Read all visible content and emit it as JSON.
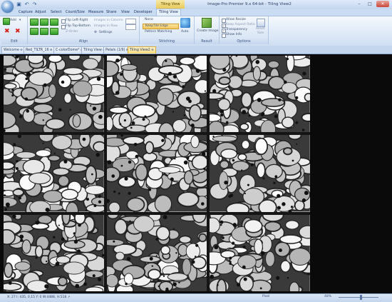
{
  "app": {
    "title": "Image-Pro Premier 9.x 64-bit - Tiling View2",
    "context_tab": "Tiling View"
  },
  "window_controls": {
    "minimize": "–",
    "maximize": "□",
    "close": "✕"
  },
  "quick_access": [
    "save-icon",
    "undo-icon",
    "redo-icon"
  ],
  "menu": {
    "tabs": [
      "Capture",
      "Adjust",
      "Select",
      "Count/Size",
      "Measure",
      "Share",
      "View",
      "Developer"
    ],
    "context": "Tiling View"
  },
  "ribbon": {
    "edit": {
      "label": "Edit",
      "add": "Add",
      "add_caret": "▾"
    },
    "align": {
      "label": "Align",
      "flip_left_right": "Flip Left-Right",
      "flip_top_bottom": "Flip Top-Bottom",
      "z_order": "Z-Order",
      "images_in_column": "Images in Column",
      "images_in_row": "Images in Row",
      "settings": "Settings",
      "column_value": "3",
      "row_value": "3"
    },
    "stitching": {
      "label": "Stitching",
      "none": "None",
      "keep_tile": "KeepTile Edge",
      "pattern_matching": "Pattern Matching",
      "auto": "Auto"
    },
    "result": {
      "label": "Result",
      "create_image": "Create Image"
    },
    "options": {
      "label": "Options",
      "allow_resize": "Allow Resize",
      "keep_aspect": "Keep Aspect Ratio",
      "transparency": "Transparency",
      "show_info": "Show Info",
      "reset": "Reset",
      "size": "Size"
    }
  },
  "doc_tabs": [
    {
      "label": "Welcome",
      "active": false
    },
    {
      "label": "Red_TILTR_16",
      "active": false
    },
    {
      "label": "C-colorDome*",
      "active": false
    },
    {
      "label": "Tiling View",
      "active": false
    },
    {
      "label": "Petals (1/9)",
      "active": false
    },
    {
      "label": "Tiling View2",
      "active": true
    }
  ],
  "tiles": {
    "rows": 3,
    "columns": 3,
    "count": 9
  },
  "status": {
    "coords": "X: 27  I: 435, 0,15 Y: 0  W:4488, H:518 ↗",
    "mode": "Pixel",
    "zoom": "48%",
    "zoom_fraction": 0.48
  },
  "colors": {
    "accent": "#f7d97b",
    "ribbon": "#dbe7f6",
    "workspace": "#0a0a0a",
    "tile_border": "#000000"
  }
}
